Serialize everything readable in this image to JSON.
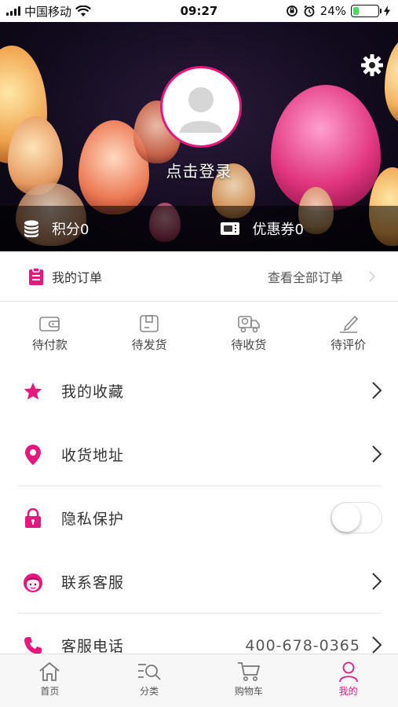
{
  "status_bar": {
    "carrier": "中国移动",
    "time": "09:27",
    "battery": "24%",
    "battery_level": 0.24
  },
  "hero": {
    "login": "点击登录",
    "points_label": "积分0",
    "coupons_label": "优惠券0"
  },
  "orders": {
    "title": "我的订单",
    "view_all": "查看全部订单",
    "statuses": [
      {
        "label": "待付款",
        "icon": "wallet-icon"
      },
      {
        "label": "待发货",
        "icon": "package-icon"
      },
      {
        "label": "待收货",
        "icon": "truck-icon"
      },
      {
        "label": "待评价",
        "icon": "pen-icon"
      }
    ]
  },
  "menu": {
    "favorites": "我的收藏",
    "address": "收货地址",
    "privacy": "隐私保护",
    "privacy_enabled": false,
    "support": "联系客服",
    "phone_label": "客服电话",
    "phone_value": "400-678-0365"
  },
  "tabs": [
    {
      "label": "首页",
      "icon": "home-icon",
      "active": false
    },
    {
      "label": "分类",
      "icon": "category-search-icon",
      "active": false
    },
    {
      "label": "购物车",
      "icon": "cart-icon",
      "active": false
    },
    {
      "label": "我的",
      "icon": "user-icon",
      "active": true
    }
  ],
  "colors": {
    "accent": "#e6177d",
    "battery_fill": "#4cd964"
  }
}
